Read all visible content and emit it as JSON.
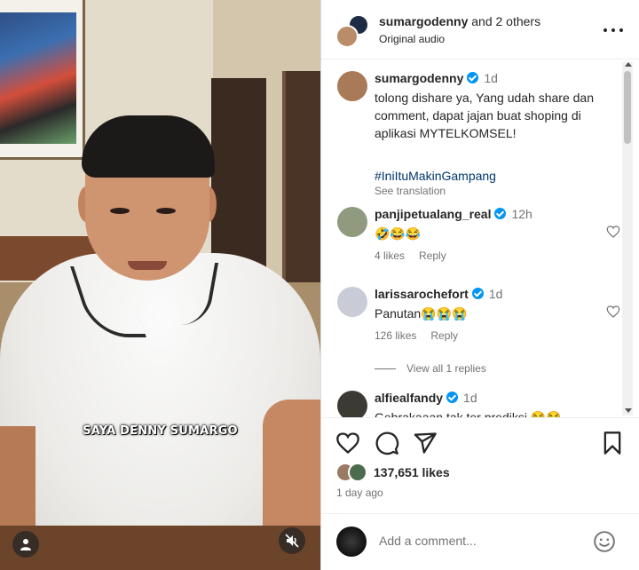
{
  "video": {
    "caption": "SAYA DENNY SUMARGO"
  },
  "header": {
    "username": "sumargodenny",
    "and_others": "and 2 others",
    "audio": "Original audio"
  },
  "post": {
    "username": "sumargodenny",
    "time": "1d",
    "text": "tolong dishare ya, Yang udah share dan comment, dapat jajan buat shoping di aplikasi MYTELKOMSEL!",
    "hashtag": "#IniItuMakinGampang",
    "see_translation": "See translation"
  },
  "comments": [
    {
      "username": "panjipetualang_real",
      "time": "12h",
      "text": "🤣😂😂",
      "likes": "4 likes",
      "reply": "Reply"
    },
    {
      "username": "larissarochefort",
      "time": "1d",
      "text": "Panutan😭😭😭",
      "likes": "126 likes",
      "reply": "Reply",
      "view_replies": "View all 1 replies"
    },
    {
      "username": "alfiealfandy",
      "time": "1d",
      "text": "Gebrakaaan tak ter prediksi 😂😂"
    }
  ],
  "actions": {
    "likes": "137,651 likes",
    "time_ago": "1 day ago"
  },
  "add_comment": {
    "placeholder": "Add a comment..."
  },
  "colors": {
    "verified": "#0095f6",
    "hashtag": "#00376b",
    "muted_text": "#737373"
  }
}
